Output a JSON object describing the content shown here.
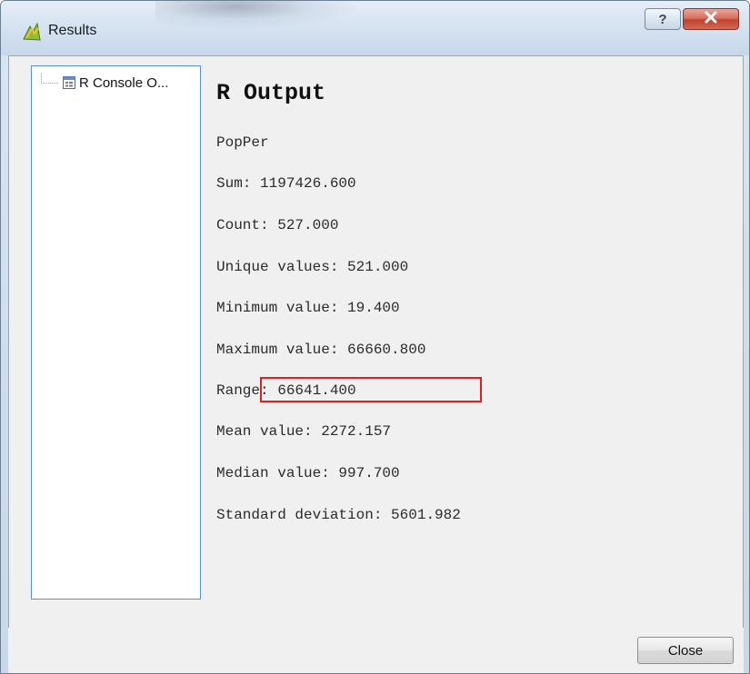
{
  "window": {
    "title": "Results",
    "help_button": "?",
    "close_icon": "close-icon"
  },
  "tree": {
    "items": [
      {
        "label": "R Console O...",
        "icon": "report-icon"
      }
    ]
  },
  "output": {
    "heading": "R Output",
    "lines": [
      "PopPer",
      "Sum: 1197426.600",
      "Count: 527.000",
      "Unique values: 521.000",
      "Minimum value: 19.400",
      "Maximum value: 66660.800",
      "Range: 66641.400",
      "Mean value: 2272.157",
      "Median value: 997.700",
      "Standard deviation: 5601.982"
    ]
  },
  "footer": {
    "close_label": "Close"
  },
  "colors": {
    "highlight": "#e02020",
    "tree_border": "#5b8fd6",
    "titlebar_close": "#c0432f"
  }
}
